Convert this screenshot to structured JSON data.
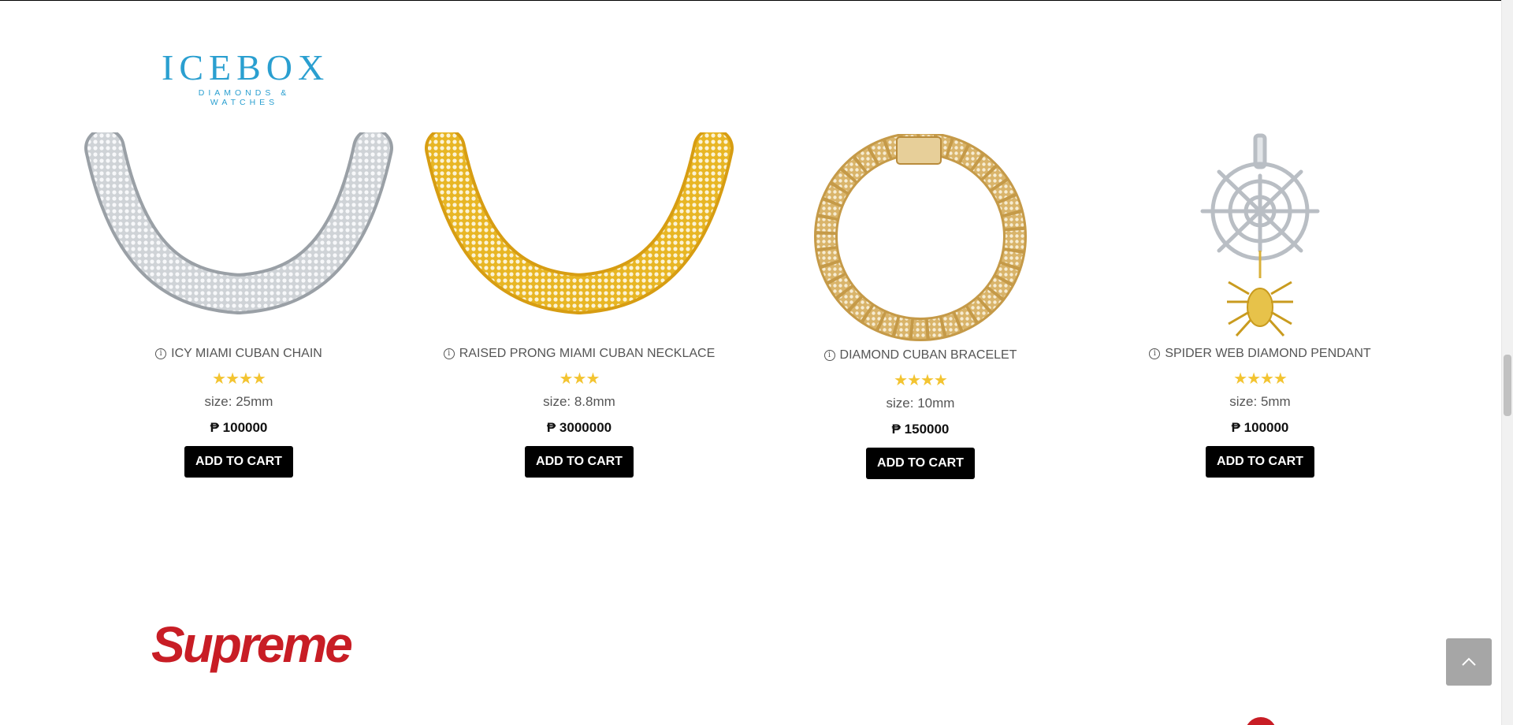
{
  "header": {
    "brand_name": "ICEBOX",
    "brand_tagline": "DIAMONDS & WATCHES"
  },
  "products": [
    {
      "title": "ICY MIAMI CUBAN CHAIN",
      "rating": 4,
      "stars": "★★★★",
      "size": "size: 25mm",
      "price": "₱ 100000",
      "button": "ADD TO CART",
      "image": "silver-cuban-chain"
    },
    {
      "title": "RAISED PRONG MIAMI CUBAN NECKLACE",
      "rating": 3,
      "stars": "★★★",
      "size": "size: 8.8mm",
      "price": "₱ 3000000",
      "button": "ADD TO CART",
      "image": "gold-cuban-necklace"
    },
    {
      "title": "DIAMOND CUBAN BRACELET",
      "rating": 4,
      "stars": "★★★★",
      "size": "size: 10mm",
      "price": "₱ 150000",
      "button": "ADD TO CART",
      "image": "gold-cuban-bracelet"
    },
    {
      "title": "SPIDER WEB DIAMOND PENDANT",
      "rating": 4,
      "stars": "★★★★",
      "size": "size: 5mm",
      "price": "₱ 100000",
      "button": "ADD TO CART",
      "image": "spider-web-pendant"
    }
  ],
  "next_brand": {
    "name": "Supreme"
  },
  "colors": {
    "brand_blue": "#2a9fd0",
    "star": "#f3c431",
    "button": "#000000",
    "supreme_red": "#c81d25"
  },
  "icons": {
    "info": "info-icon",
    "back_to_top": "chevron-up-icon"
  }
}
